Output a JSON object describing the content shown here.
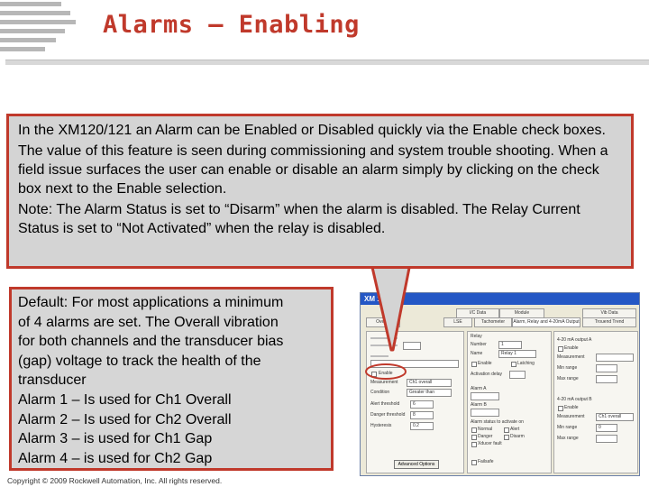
{
  "title": "Alarms – Enabling",
  "top_callout": {
    "p1": "In the XM120/121 an Alarm can be Enabled or Disabled quickly via the Enable check boxes.",
    "p2": "The value of this feature is seen during commissioning and system trouble shooting. When a field issue surfaces the user can enable or disable an alarm simply by clicking on the check box next to the Enable selection.",
    "p3": "Note: The Alarm Status is set to “Disarm” when the alarm is disabled. The Relay Current Status is set to “Not Activated” when the relay is disabled."
  },
  "left_callout": {
    "lines": [
      "Default: For most applications a minimum",
      "of 4 alarms are set. The Overall vibration",
      "for both channels and the transducer bias",
      "(gap) voltage to track the health of the",
      "transducer",
      "Alarm 1 – Is used for Ch1 Overall",
      "Alarm 2 – Is used for Ch2 Overall",
      "Alarm 3 – is used for Ch1 Gap",
      "Alarm 4 – is used for Ch2 Gap"
    ]
  },
  "screenshot": {
    "window_title": "XM 12",
    "tabs": [
      "I/C Data",
      "Module",
      "Vib Data",
      "Overall",
      "Tachometer",
      "Alarm, Relay and 4-20mA Output",
      "Trouend Trend",
      "LSE"
    ],
    "alarm_panel": {
      "enable_label": "Enable",
      "measurement_label": "Measurement",
      "measurement_value": "Ch1 overall",
      "condition_label": "Condition",
      "condition_value": "Greater than",
      "alert_threshold_label": "Alert threshold",
      "alert_threshold_value": "6",
      "danger_threshold_label": "Danger threshold",
      "danger_threshold_value": "8",
      "hysteresis_label": "Hysteresis",
      "hysteresis_value": "0.2",
      "advanced_button": "Advanced Options"
    },
    "relay_panel": {
      "relay_label": "Relay",
      "number_label": "Number",
      "number_value": "1",
      "name_label": "Name",
      "name_value": "Relay 1",
      "enable_label": "Enable",
      "latching_label": "Latching",
      "activation_delay_label": "Activation delay",
      "alarm_a_label": "Alarm A",
      "alarm_b_label": "Alarm B",
      "alarm_status_label": "Alarm status to activate on",
      "normal_label": "Normal",
      "alert_label": "Alert",
      "danger_label": "Danger",
      "disarm_label": "Disarm",
      "xducer_fault_label": "Xducer fault",
      "failsafe_label": "Failsafe"
    },
    "output_panel": {
      "out_a_label": "4-20 mA output A",
      "out_b_label": "4-20 mA output B",
      "enable_label": "Enable",
      "measurement_label": "Measurement",
      "measurement_value": "Ch1 overall",
      "min_range_label": "Min range",
      "max_range_label": "Max range",
      "value": "0"
    }
  },
  "footer": "Copyright © 2009 Rockwell Automation, Inc. All rights reserved.",
  "colors": {
    "accent": "#c0392b",
    "callout_fill": "#d4d4d4"
  }
}
